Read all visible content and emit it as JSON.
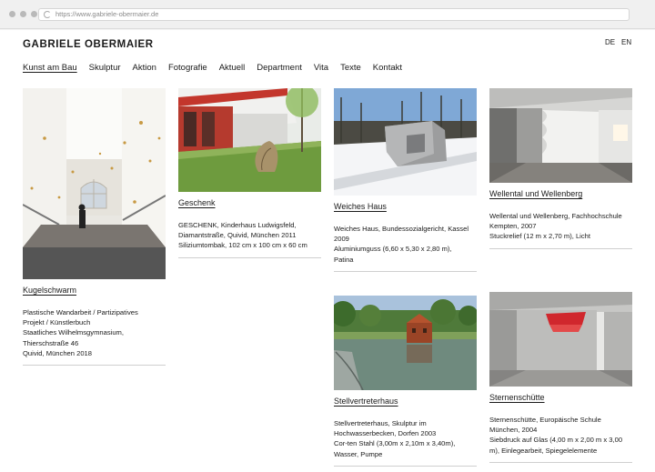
{
  "browser": {
    "url": "https://www.gabriele-obermaier.de"
  },
  "site": {
    "brand": "GABRIELE OBERMAIER",
    "lang": [
      "DE",
      "EN"
    ],
    "nav": [
      "Kunst am Bau",
      "Skulptur",
      "Aktion",
      "Fotografie",
      "Aktuell",
      "Department",
      "Vita",
      "Texte",
      "Kontakt"
    ],
    "active_nav": "Kunst am Bau"
  },
  "works": [
    {
      "title": "Kugelschwarm",
      "lines": [
        "Plastische Wandarbeit / Partizipatives",
        "Projekt / Künstlerbuch",
        "Staatliches Wilhelmsgymnasium,",
        "Thierschstraße 46",
        "Quivid, München 2018"
      ]
    },
    {
      "title": "Geschenk",
      "lines": [
        "GESCHENK, Kinderhaus Ludwigsfeld,",
        "Diamantstraße, Quivid, München 2011",
        "Siliziumtombak, 102 cm x 100 cm x 60 cm"
      ]
    },
    {
      "title": "Weiches Haus",
      "lines": [
        "Weiches Haus, Bundessozialgericht, Kassel",
        "2009",
        "Aluminiumguss (6,60 x 5,30 x 2,80 m),",
        "Patina"
      ]
    },
    {
      "title": "Wellental und Wellenberg",
      "lines": [
        "Wellental und Wellenberg, Fachhochschule",
        "Kempten, 2007",
        "Stuckrelief (12 m x 2,70 m), Licht"
      ]
    },
    {
      "title": "Stellvertreterhaus",
      "lines": [
        "Stellvertreterhaus, Skulptur im",
        "Hochwasserbecken, Dorfen 2003",
        "Cor-ten Stahl (3,00m x 2,10m x 3,40m),",
        "Wasser, Pumpe"
      ]
    },
    {
      "title": "Sternenschütte",
      "lines": [
        "Sternenschütte, Europäische Schule",
        "München, 2004",
        "Siebdruck auf Glas (4,00 m x 2,00 m x 3,00",
        "m), Einlegearbeit, Spiegelelemente"
      ]
    }
  ]
}
